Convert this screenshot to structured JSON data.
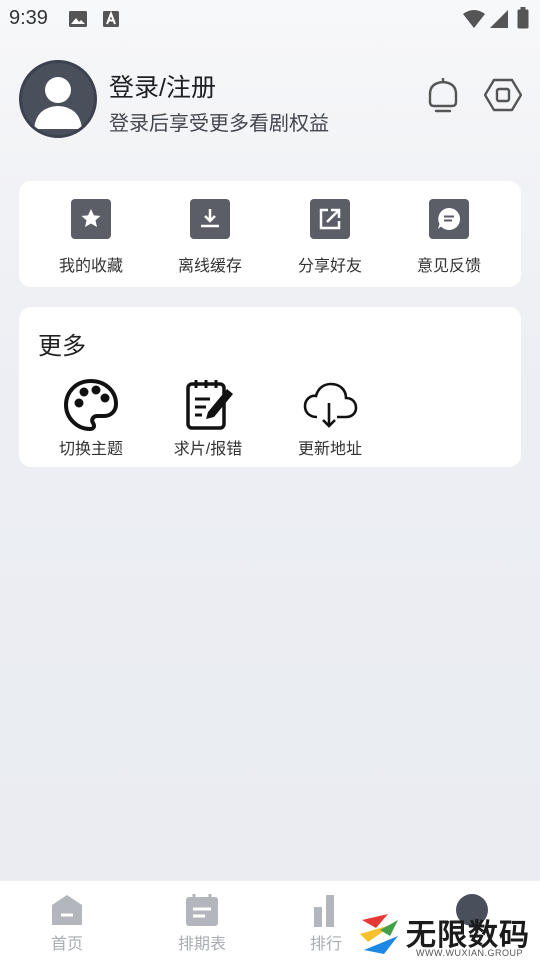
{
  "status_bar": {
    "time": "9:39",
    "icons": [
      "image-icon",
      "text-a-icon",
      "wifi-icon",
      "signal-icon",
      "battery-icon"
    ]
  },
  "profile": {
    "title": "登录/注册",
    "subtitle": "登录后享受更多看剧权益",
    "icons": [
      "tv-icon",
      "settings-hexagon-icon"
    ]
  },
  "quick_actions": [
    {
      "label": "我的收藏",
      "icon": "star-icon"
    },
    {
      "label": "离线缓存",
      "icon": "download-icon"
    },
    {
      "label": "分享好友",
      "icon": "share-icon"
    },
    {
      "label": "意见反馈",
      "icon": "message-icon"
    }
  ],
  "more": {
    "title": "更多",
    "items": [
      {
        "label": "切换主题",
        "icon": "palette-icon"
      },
      {
        "label": "求片/报错",
        "icon": "notepad-edit-icon"
      },
      {
        "label": "更新地址",
        "icon": "cloud-download-icon"
      }
    ]
  },
  "bottom_nav": [
    {
      "label": "首页",
      "icon": "home-icon"
    },
    {
      "label": "排期表",
      "icon": "calendar-icon"
    },
    {
      "label": "排行",
      "icon": "ranking-icon"
    },
    {
      "label": "",
      "icon": "profile-icon"
    }
  ],
  "watermark": {
    "text": "无限数码",
    "subtext": "WWW.WUXIAN.GROUP"
  },
  "colors": {
    "icon_dark": "#5b5e67",
    "nav_inactive": "#a9acb3",
    "card_bg": "#ffffff"
  }
}
